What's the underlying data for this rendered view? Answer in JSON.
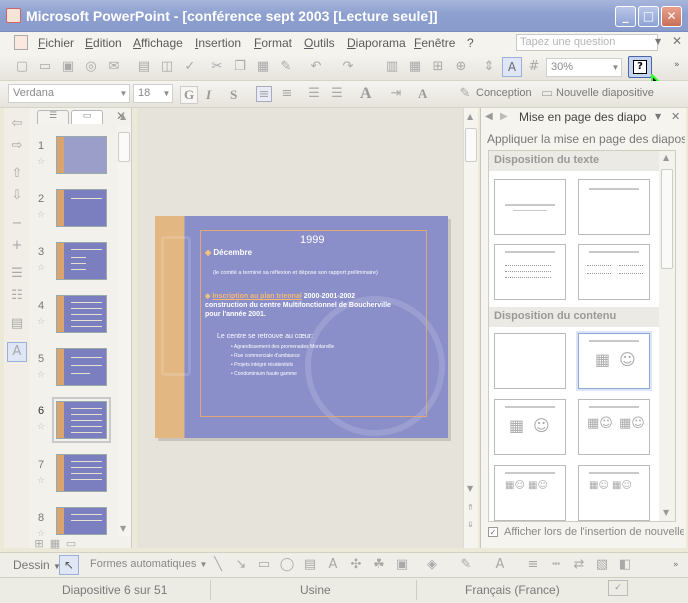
{
  "window": {
    "title": "Microsoft PowerPoint - [conférence sept 2003 [Lecture seule]]"
  },
  "menu": [
    "Fichier",
    "Edition",
    "Affichage",
    "Insertion",
    "Format",
    "Outils",
    "Diaporama",
    "Fenêtre",
    "?"
  ],
  "help": {
    "placeholder": "Tapez une question"
  },
  "toolbar": {
    "zoom": "30%",
    "font": "Verdana",
    "size": "18",
    "design": "Conception",
    "new_slide": "Nouvelle diapositive"
  },
  "thumbs": [
    "1",
    "2",
    "3",
    "4",
    "5",
    "6",
    "7",
    "8"
  ],
  "slide": {
    "year": "1999",
    "b1": "Décembre",
    "b1sub": "(le comité a terminé sa réflexion et dépose son rapport préliminaire)",
    "b2link": "Inscription au plan triennal",
    "b2rest": "2000-2001-2002 construction du centre Multifonctionnel de Boucherville pour l'année 2001.",
    "centre": "Le centre se retrouve au cœur:",
    "items": [
      "Agrandissement des promenades Montarville",
      "Rue commerciale d'ambiance",
      "Projets intégré résidentiels",
      "Condominium haute gamme"
    ]
  },
  "taskpane": {
    "title": "Mise en page des diapos",
    "apply": "Appliquer la mise en page des diapos:",
    "sec_text": "Disposition du texte",
    "sec_content": "Disposition du contenu",
    "check": "Afficher lors de l'insertion de nouvelles diapos"
  },
  "drawing": {
    "dessin": "Dessin",
    "autoshapes": "Formes automatiques"
  },
  "status": {
    "slide": "Diapositive 6 sur 51",
    "design": "Usine",
    "lang": "Français (France)"
  }
}
